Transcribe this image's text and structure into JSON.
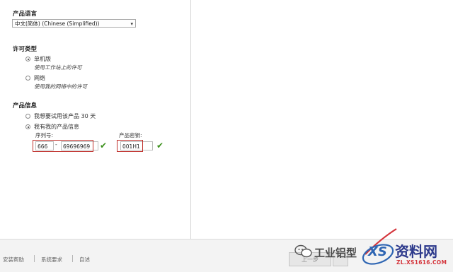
{
  "language": {
    "title": "产品语言",
    "selected": "中文(简体) (Chinese (Simplified))"
  },
  "license": {
    "title": "许可类型",
    "options": [
      {
        "label": "单机版",
        "desc": "使用工作站上的许可",
        "checked": true
      },
      {
        "label": "网络",
        "desc": "使用我的网络中的许可",
        "checked": false
      }
    ]
  },
  "product_info": {
    "title": "产品信息",
    "trial_label": "我想要试用该产品 30 天",
    "have_info_label": "我有我的产品信息",
    "serial_label": "序列号:",
    "serial_prefix": "666",
    "serial_dash": "-",
    "serial_number": "69696969",
    "key_label": "产品密钥:",
    "key_value": "001H1"
  },
  "footer": {
    "links": [
      "安装帮助",
      "系统要求",
      "自述"
    ],
    "back_button": "上一步"
  },
  "watermark": {
    "wechat": "工业铝型",
    "site_name": "资料网",
    "site_url": "ZL.XS1616.COM",
    "logo_letters": "XS"
  }
}
